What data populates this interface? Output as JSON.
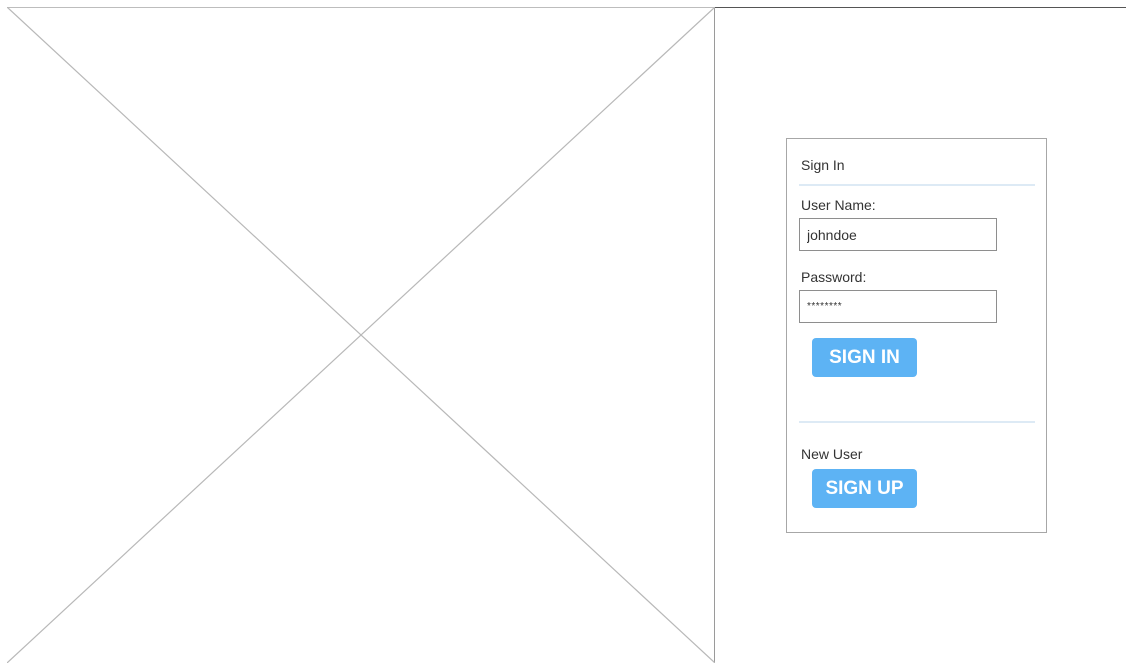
{
  "login": {
    "title": "Sign In",
    "username_label": "User Name:",
    "username_value": "johndoe",
    "password_label": "Password:",
    "password_value": "********",
    "signin_button": "SIGN IN",
    "new_user_label": "New User",
    "signup_button": "SIGN UP"
  },
  "colors": {
    "button": "#5db3f4",
    "divider": "#ddeaf5",
    "border": "#a7a7a7"
  },
  "icons": {
    "placeholder": "image-placeholder-icon"
  }
}
